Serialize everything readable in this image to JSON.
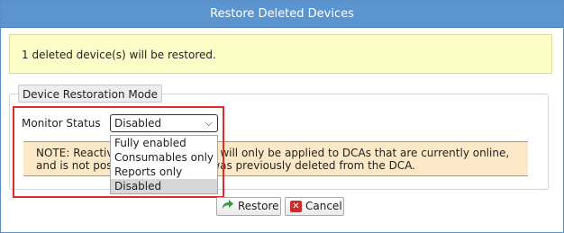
{
  "dialog": {
    "title": "Restore Deleted Devices",
    "info_message": "1 deleted device(s) will be restored."
  },
  "restoration": {
    "legend": "Device Restoration Mode",
    "monitor_status_label": "Monitor Status",
    "select_value": "Disabled",
    "options": [
      "Fully enabled",
      "Consumables only",
      "Reports only",
      "Disabled"
    ],
    "note": "NOTE: Reactivation of monitoring will only be applied to DCAs that are currently online, and is not possible if the device was previously deleted from the DCA."
  },
  "buttons": {
    "restore": "Restore",
    "cancel": "Cancel"
  },
  "colors": {
    "titlebar": "#5b95d0",
    "info_bg": "#fdfdc8",
    "note_bg": "#fde9c7",
    "highlight": "#e02b2b"
  }
}
